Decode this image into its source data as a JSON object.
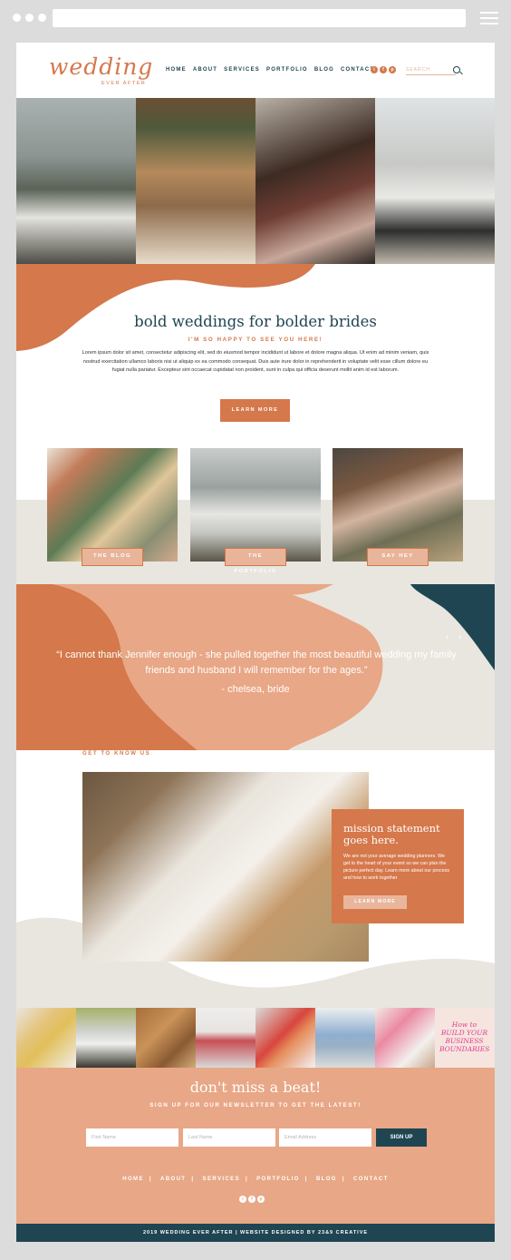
{
  "header": {
    "logo_script": "wedding",
    "logo_sub": "EVER AFTER",
    "nav": [
      "HOME",
      "ABOUT",
      "SERVICES",
      "PORTFOLIO",
      "BLOG",
      "CONTACT"
    ],
    "social": [
      "i",
      "f",
      "p"
    ],
    "search_placeholder": "SEARCH"
  },
  "intro": {
    "title": "bold weddings for bolder brides",
    "subtitle": "I'M SO HAPPY TO SEE YOU HERE!",
    "body": "Lorem ipsum dolor sit amet, consectetur adipiscing elit, sed do eiusmod tempor incididunt ut labore et dolore magna aliqua. Ut enim ad minim veniam, quis nostrud exercitation ullamco laboris nisi ut aliquip ex ea commodo consequat. Duis aute irure dolor in reprehenderit in voluptate velit esse cillum dolore eu fugiat nulla pariatur. Excepteur sint occaecat cupidatat non proident, sunt in culpa qui officia deserunt mollit anim id est laborum.",
    "button": "LEARN MORE"
  },
  "cards": [
    "THE BLOG",
    "THE PORTFOLIO",
    "SAY HEY"
  ],
  "testimonial": {
    "quote": "“I cannot thank Jennifer enough - she pulled together the most beautiful wedding my family friends and husband I will remember for the ages.”",
    "cite": "- chelsea, bride",
    "arrows": "‹ ›"
  },
  "about": {
    "eyebrow": "GET TO KNOW US",
    "title": "mission statement goes here.",
    "body": "We are not your average wedding planners. We get to the heart of your event so we can plan the picture perfect day. Learn more about our process and how to work together",
    "button": "LEARN MORE"
  },
  "instagram": {
    "last_tile_text": "How to BUILD YOUR BUSINESS BOUNDARIES"
  },
  "newsletter": {
    "title": "don't miss a beat!",
    "subtitle": "SIGN UP FOR OUR NEWSLETTER TO GET THE LATEST!",
    "first_name": "First Name",
    "last_name": "Last Name",
    "email": "Email Address",
    "button": "SIGN UP"
  },
  "footer": {
    "nav": [
      "HOME",
      "ABOUT",
      "SERVICES",
      "PORTFOLIO",
      "BLOG",
      "CONTACT"
    ],
    "separator": "|",
    "social": [
      "i",
      "f",
      "p"
    ],
    "copyright": "2019 WEDDING EVER AFTER | WEBSITE DESIGNED BY 23&9 CREATIVE"
  },
  "colors": {
    "orange": "#d5784b",
    "peach": "#e8a786",
    "navy": "#1f4553",
    "beige": "#e8e6df"
  }
}
